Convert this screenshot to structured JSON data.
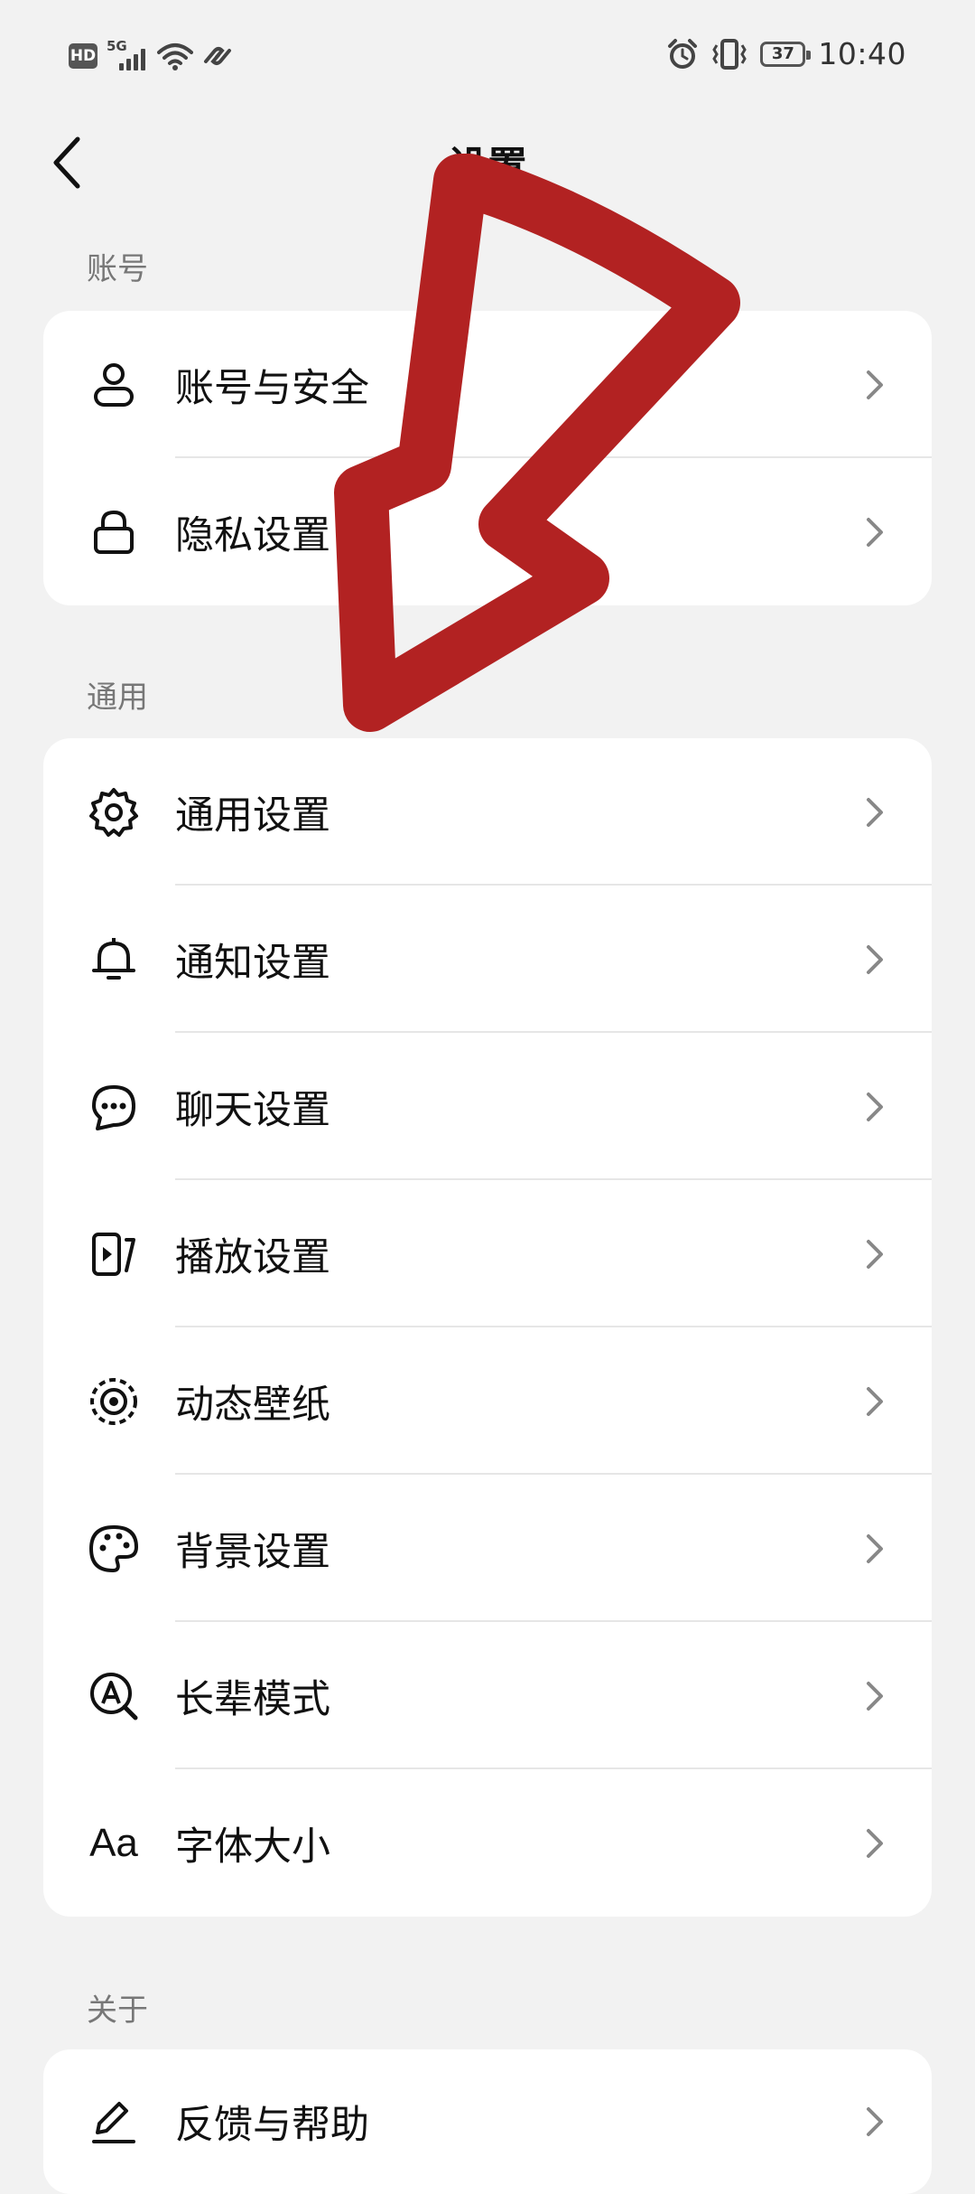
{
  "status_bar": {
    "hd_badge": "HD",
    "network_label": "5G",
    "time": "10:40",
    "battery": "37"
  },
  "header": {
    "title": "设置"
  },
  "sections": {
    "account": {
      "label": "账号",
      "items": [
        {
          "label": "账号与安全",
          "icon": "user-icon"
        },
        {
          "label": "隐私设置",
          "icon": "lock-icon"
        }
      ]
    },
    "general": {
      "label": "通用",
      "items": [
        {
          "label": "通用设置",
          "icon": "gear-icon"
        },
        {
          "label": "通知设置",
          "icon": "bell-icon"
        },
        {
          "label": "聊天设置",
          "icon": "chat-icon"
        },
        {
          "label": "播放设置",
          "icon": "play-phone-icon"
        },
        {
          "label": "动态壁纸",
          "icon": "live-wallpaper-icon"
        },
        {
          "label": "背景设置",
          "icon": "palette-icon"
        },
        {
          "label": "长辈模式",
          "icon": "elder-mode-icon"
        },
        {
          "label": "字体大小",
          "icon": "font-size-icon",
          "glyph": "Aa"
        }
      ]
    },
    "about": {
      "label": "关于",
      "items": [
        {
          "label": "反馈与帮助",
          "icon": "edit-icon"
        }
      ]
    }
  },
  "colors": {
    "background": "#f2f2f2",
    "card": "#ffffff",
    "annotation_arrow": "#b22222"
  }
}
